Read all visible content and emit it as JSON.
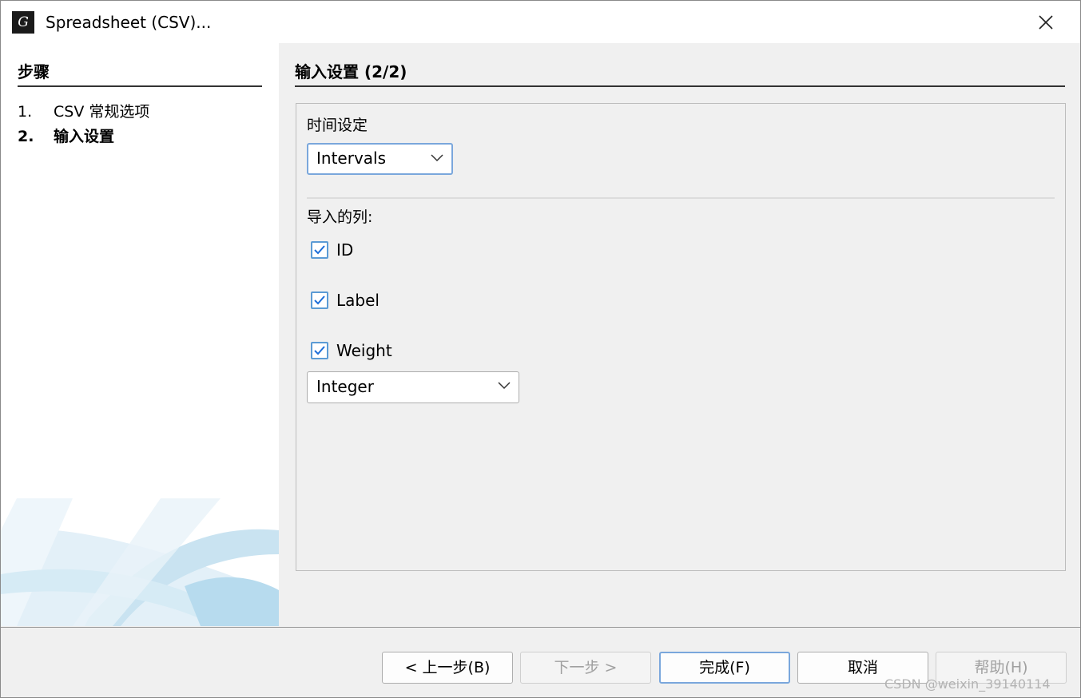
{
  "window": {
    "title": "Spreadsheet (CSV)...",
    "icon_name": "app-logo-icon",
    "close_icon": "close-icon"
  },
  "steps": {
    "title": "步骤",
    "items": [
      {
        "number": "1.",
        "label": "CSV 常规选项",
        "active": false
      },
      {
        "number": "2.",
        "label": "输入设置",
        "active": true
      }
    ]
  },
  "content": {
    "title": "输入设置 (2/2)",
    "time_setting": {
      "label": "时间设定",
      "value": "Intervals"
    },
    "columns": {
      "label": "导入的列:",
      "items": [
        {
          "label": "ID",
          "checked": true
        },
        {
          "label": "Label",
          "checked": true
        },
        {
          "label": "Weight",
          "checked": true
        }
      ],
      "weight_type": "Integer"
    }
  },
  "buttons": {
    "back": "< 上一步(B)",
    "next": "下一步 >",
    "finish": "完成(F)",
    "cancel": "取消",
    "help": "帮助(H)"
  },
  "watermark": "CSDN @weixin_39140114",
  "colors": {
    "accent": "#5b9bd5",
    "focus_border": "#7aa7dc"
  }
}
